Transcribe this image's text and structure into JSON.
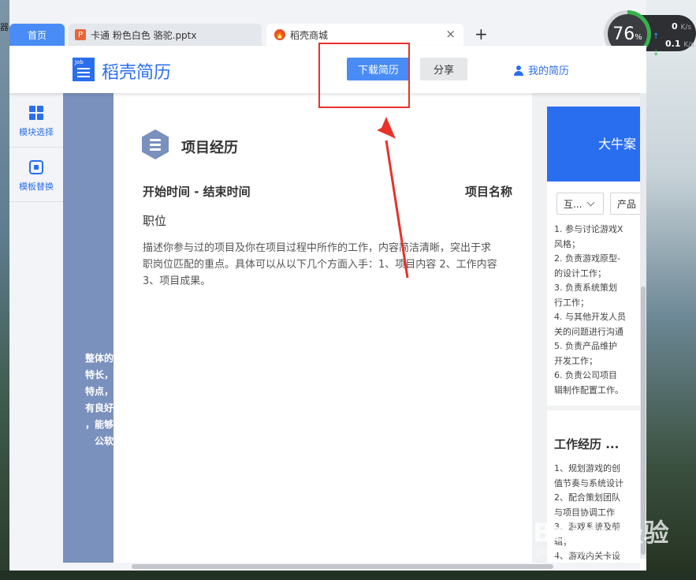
{
  "desktop": {
    "left_cut_text": "器"
  },
  "browser": {
    "tabs": [
      {
        "label": "首页"
      },
      {
        "label": "卡通 粉色白色 骆驼.pptx",
        "icon": "P"
      },
      {
        "label": "稻壳商城",
        "icon": "🔥"
      }
    ],
    "new_tab": "+",
    "close_tab": "×"
  },
  "speed_widget": {
    "percent": "76",
    "percent_unit": "%",
    "up_value": "0",
    "down_value": "0.1",
    "unit": "K/s"
  },
  "app": {
    "logo_small": "Job",
    "logo_text": "稻壳简历",
    "download_button": "下载简历",
    "share_button": "分享",
    "my_resume": "我的简历"
  },
  "sidebar": {
    "items": [
      {
        "label": "模块选择"
      },
      {
        "label": "模板替换"
      }
    ]
  },
  "resume": {
    "strip_lines": [
      "整体的",
      "特长，",
      "特点，",
      "有良好",
      "，能够",
      "公软"
    ],
    "section_title": "项目经历",
    "time_range": "开始时间 - 结束时间",
    "project_name": "项目名称",
    "position": "职位",
    "description": "描述你参与过的项目及你在项目过程中所作的工作，内容简洁清晰，突出于求职岗位匹配的重点。具体可以从以下几个方面入手：1、项目内容 2、工作内容 3、项目成果。"
  },
  "right_panel": {
    "banner": "大牛案",
    "select1": "互...",
    "select2": "产品",
    "card1_lines": "1. 参与讨论游戏X\n风格；\n2. 负责游戏原型-\n的设计工作；\n3. 负责系统策划\n行工作；\n4. 与其他开发人员\n关的问题进行沟通\n5. 负责产品维护\n开发工作；\n6. 负责公司项目\n辑制作配置工作。",
    "card2_title": "工作经历 ...",
    "card2_lines": "1、规划游戏的创\n值节奏与系统设计\n2、配合策划团队\n与项目协调工作\n3、游戏系统及前\n辑；\n4、游戏内关卡设"
  },
  "watermark": {
    "main": "Baidu经验",
    "sub": "jingyan.baidu.com"
  }
}
